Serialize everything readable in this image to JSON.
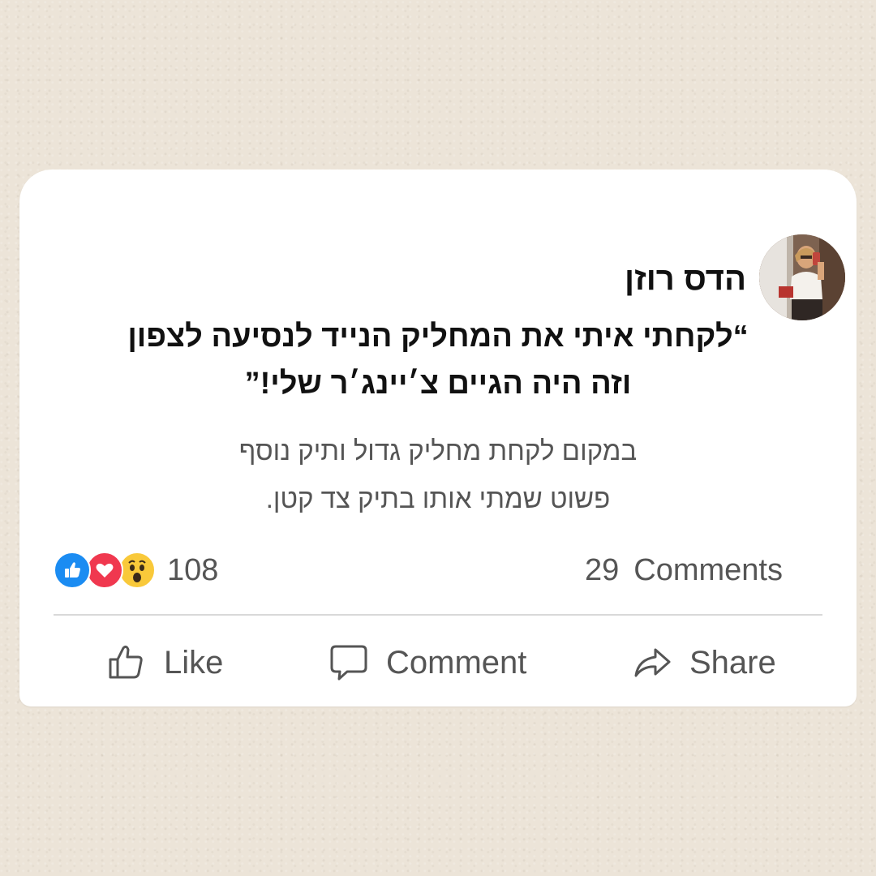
{
  "post": {
    "author": "הדס רוזן",
    "avatar_icon": "profile-photo",
    "headline_lines": [
      "“לקחתי איתי את המחליק הנייד לנסיעה לצפון",
      "וזה היה הגיים צ׳יינג׳ר שלי!”"
    ],
    "body_lines": [
      "במקום לקחת מחליק גדול ותיק נוסף",
      "פשוט שמתי אותו בתיק צד קטן."
    ]
  },
  "stats": {
    "reactions": [
      "like-reaction-icon",
      "love-reaction-icon",
      "wow-reaction-icon"
    ],
    "reaction_count": "108",
    "comment_count": "29",
    "comments_label": "Comments"
  },
  "actions": {
    "like": "Like",
    "comment": "Comment",
    "share": "Share"
  },
  "colors": {
    "background": "#ece4d8",
    "card": "#ffffff",
    "like_blue": "#1b8cf2",
    "love_red": "#f0384f",
    "wow_yellow": "#f9c93a",
    "secondary_text": "#555555"
  }
}
